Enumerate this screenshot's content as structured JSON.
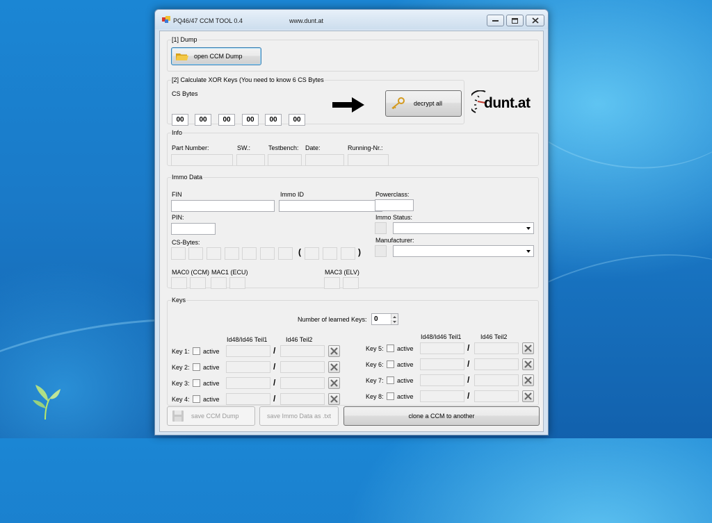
{
  "window": {
    "title": "PQ46/47 CCM TOOL 0.4",
    "url_text": "www.dunt.at"
  },
  "dump": {
    "group_label": "[1] Dump",
    "open_button": "open CCM Dump"
  },
  "xor": {
    "group_label": "[2] Calculate XOR Keys (You need to know 6 CS Bytes",
    "cs_bytes_label": "CS Bytes",
    "cs_bytes": [
      "00",
      "00",
      "00",
      "00",
      "00",
      "00"
    ],
    "decrypt_button": "decrypt all",
    "logo_text": "dunt.at"
  },
  "info": {
    "group_label": "Info",
    "part_number_label": "Part Number:",
    "sw_label": "SW.:",
    "testbench_label": "Testbench:",
    "date_label": "Date:",
    "running_nr_label": "Running-Nr.:"
  },
  "immo": {
    "group_label": "Immo Data",
    "fin_label": "FIN",
    "immo_id_label": "Immo ID",
    "pin_label": "PIN:",
    "cs_bytes_label": "CS-Bytes:",
    "paren_open": "(",
    "paren_close": ")",
    "mac0_label": "MAC0 (CCM)",
    "mac1_label": "MAC1 (ECU)",
    "mac3_label": "MAC3 (ELV)",
    "powerclass_label": "Powerclass:",
    "immo_status_label": "Immo Status:",
    "manufacturer_label": "Manufacturer:"
  },
  "keys": {
    "group_label": "Keys",
    "learned_label": "Number of learned Keys:",
    "learned_value": "0",
    "col1_header": "Id48/Id46 Teil1",
    "col2_header": "Id46 Teil2",
    "active_label": "active",
    "separator": "/",
    "left": [
      {
        "label": "Key 1:"
      },
      {
        "label": "Key 2:"
      },
      {
        "label": "Key 3:"
      },
      {
        "label": "Key 4:"
      }
    ],
    "right": [
      {
        "label": "Key 5:"
      },
      {
        "label": "Key 6:"
      },
      {
        "label": "Key 7:"
      },
      {
        "label": "Key 8:"
      }
    ]
  },
  "actions": {
    "save_dump": "save CCM Dump",
    "save_immo": "save Immo Data as .txt",
    "clone": "clone a CCM to another"
  }
}
